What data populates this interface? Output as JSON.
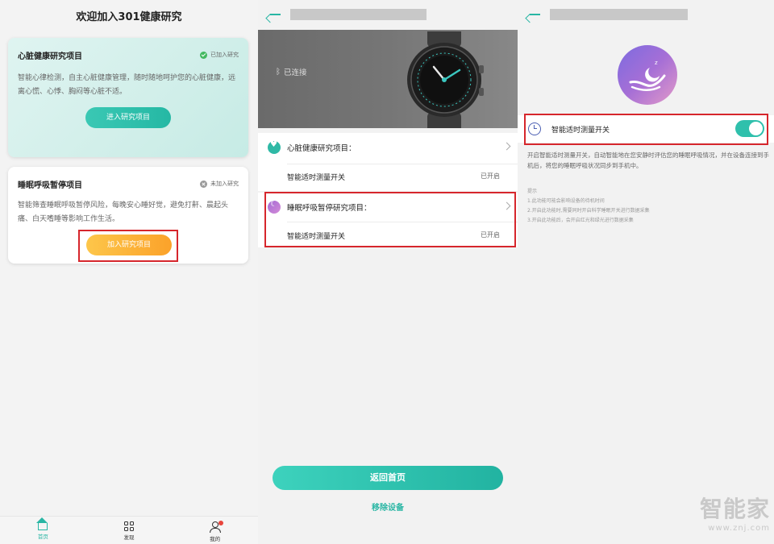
{
  "panel1": {
    "title": "欢迎加入301健康研究",
    "heart_card": {
      "title": "心脏健康研究项目",
      "badge": "已加入研究",
      "desc": "智能心律检测，自主心脏健康管理，随时随地呵护您的心脏健康，远离心慌、心悸、胸闷等心脏不适。",
      "button": "进入研究项目"
    },
    "sleep_card": {
      "title": "睡眠呼吸暂停项目",
      "badge": "未加入研究",
      "desc": "智能筛查睡眠呼吸暂停风险，每晚安心睡好觉，避免打鼾、晨起头痛、白天嗜睡等影响工作生活。",
      "button": "加入研究项目"
    },
    "nav": [
      {
        "label": "首页",
        "icon": "home-icon",
        "active": true
      },
      {
        "label": "发现",
        "icon": "discover-icon",
        "active": false
      },
      {
        "label": "我的",
        "icon": "profile-icon",
        "active": false
      }
    ],
    "colors": {
      "accent": "#29b6a4",
      "join": "#fba22a",
      "highlight": "#d6262c"
    }
  },
  "panel2": {
    "bt_status": "已连接",
    "heart_item": {
      "title": "心脏健康研究项目：",
      "sub": "智能适时测量开关",
      "value": "已开启"
    },
    "sleep_item": {
      "title": "睡眠呼吸暂停研究项目：",
      "sub": "智能适时测量开关",
      "value": "已开启"
    },
    "btn_home": "返回首页",
    "btn_remove": "移除设备"
  },
  "panel3": {
    "toggle_label": "智能适时测量开关",
    "toggle_on": true,
    "desc": "开启智能适时测量开关，自动智能地在您安静时评估您的睡眠呼吸情况，并在设备连接到手机后，将您的睡眠呼吸状况同步到手机中。",
    "tips_title": "提示",
    "tips": [
      "1.此功能可能会影响设备的待机时间",
      "2.开启此功能时,需要同时开启科学睡眠开关进行数据采集",
      "3.开启此功能后，会开启红光和绿光进行数据采集"
    ]
  },
  "watermark": {
    "big": "智能家",
    "small": "www.znj.com"
  }
}
